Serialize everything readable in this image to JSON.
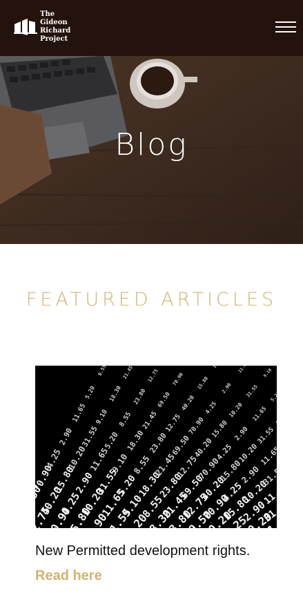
{
  "header": {
    "logo_lines": [
      "The",
      "Gideon",
      "Richard",
      "Project"
    ],
    "menu_icon": "hamburger-menu-icon"
  },
  "hero": {
    "title": "Blog"
  },
  "featured": {
    "heading": "FEATURED ARTICLES",
    "articles": [
      {
        "title": "New Permitted development rights.",
        "link_label": "Read here",
        "image_numbers": [
          "21.45",
          "69.50",
          "70.90",
          "4.25",
          "2.90",
          "11.65",
          "5.20",
          "8.55",
          "23.80",
          "12.75",
          "40.20",
          "15.80",
          "10.20",
          "31.55",
          "9.10",
          "18.30"
        ]
      }
    ]
  },
  "colors": {
    "header_bg": "#24120c",
    "accent_gold": "#d1b471",
    "text_dark": "#111111"
  }
}
